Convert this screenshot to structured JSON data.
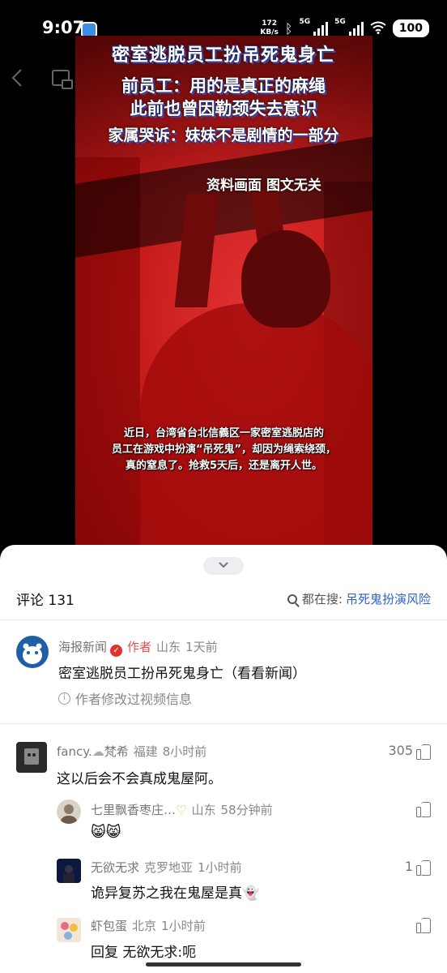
{
  "status": {
    "time": "9:07",
    "net_speed_value": "172",
    "net_speed_unit": "KB/s",
    "sig1_label": "5G",
    "sig2_label": "5G",
    "battery": "100",
    "icons": [
      "app-badge-icon",
      "bluetooth-icon",
      "signal-icon",
      "wifi-icon",
      "battery-icon"
    ]
  },
  "video": {
    "headline": "密室逃脱员工扮吊死鬼身亡",
    "line1": "前员工：用的是真正的麻绳",
    "line2": "此前也曾因勒颈失去意识",
    "line3": "家属哭诉：妹妹不是剧情的一部分",
    "disclaimer": "资料画面 图文无关",
    "caption1": "近日，台湾省台北信義区一家密室逃脱店的",
    "caption2": "员工在游戏中扮演“吊死鬼”，却因为绳索绕颈，",
    "caption3": "真的窒息了。抢救5天后，还是离开人世。"
  },
  "comments_header": {
    "count_label": "评论 131",
    "search_prefix": "都在搜:",
    "search_keyword": "吊死鬼扮演风险"
  },
  "author_post": {
    "name": "海报新闻",
    "author_tag": "作者",
    "location": "山东",
    "time": "1天前",
    "text": "密室逃脱员工扮吊死鬼身亡（看看新闻）",
    "info": "作者修改过视频信息"
  },
  "comments": [
    {
      "name": "fancy.",
      "name_suffix": "梵希",
      "location": "福建",
      "time": "8小时前",
      "text": "这以后会不会真成鬼屋阿。",
      "likes": "305"
    },
    {
      "name": "七里飘香枣庄…",
      "location": "山东",
      "time": "58分钟前",
      "text": "😸😸",
      "likes": ""
    },
    {
      "name": "无欲无求",
      "location": "克罗地亚",
      "time": "1小时前",
      "text": "诡异复苏之我在鬼屋是真👻",
      "likes": "1"
    },
    {
      "name": "虾包蛋",
      "location": "北京",
      "time": "1小时前",
      "text": "回复 无欲无求:呃",
      "likes": ""
    }
  ]
}
